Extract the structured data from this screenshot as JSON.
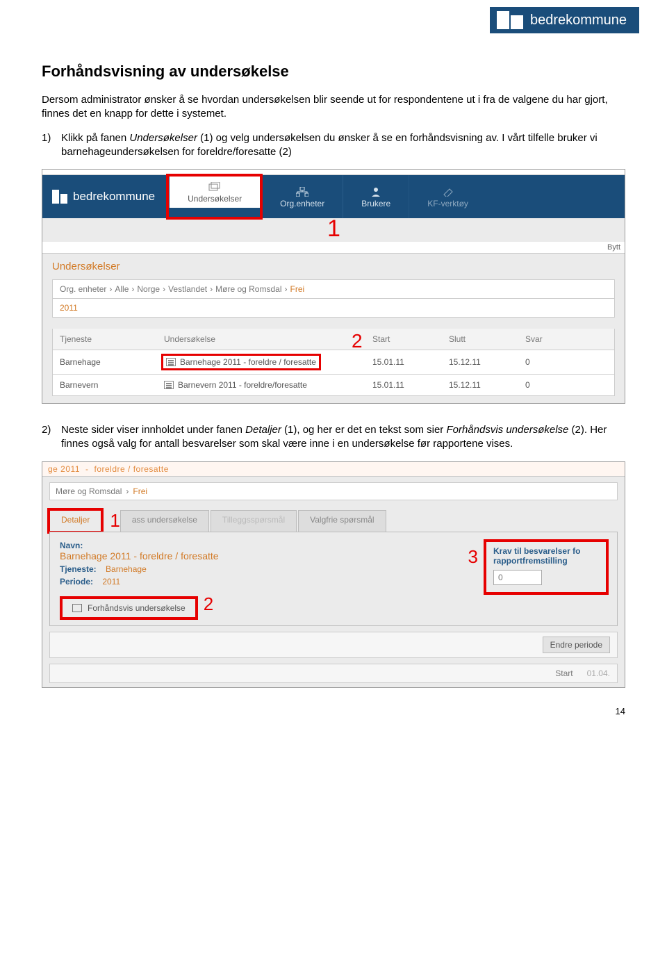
{
  "logo_text": "bedrekommune",
  "title": "Forhåndsvisning av undersøkelse",
  "intro": "Dersom administrator ønsker å se hvordan undersøkelsen blir seende ut for respondentene ut i fra de valgene du har gjort, finnes det en knapp for dette i systemet.",
  "step1_a": "Klikk på fanen ",
  "step1_i": "Undersøkelser",
  "step1_b": " (1) og velg undersøkelsen du ønsker å se en forhåndsvisning av. I vårt tilfelle bruker vi barnehageundersøkelsen for foreldre/foresatte (2)",
  "step1_num": "1)",
  "shot1": {
    "brand": "bedrekommune",
    "tabs": {
      "t1": "Undersøkelser",
      "t2": "Org.enheter",
      "t3": "Brukere",
      "t4": "KF-verktøy"
    },
    "marker1": "1",
    "bytt": "Bytt",
    "panel_title": "Undersøkelser",
    "crumbs": {
      "c0": "Org. enheter",
      "c1": "Alle",
      "c2": "Norge",
      "c3": "Vestlandet",
      "c4": "Møre og Romsdal",
      "c5": "Frei",
      "sep": "›"
    },
    "year": "2011",
    "cols": {
      "tjeneste": "Tjeneste",
      "under": "Undersøkelse",
      "start": "Start",
      "slutt": "Slutt",
      "svar": "Svar"
    },
    "marker2": "2",
    "rows": [
      {
        "tjeneste": "Barnehage",
        "under": "Barnehage 2011 - foreldre / foresatte",
        "start": "15.01.11",
        "slutt": "15.12.11",
        "svar": "0"
      },
      {
        "tjeneste": "Barnevern",
        "under": "Barnevern 2011 - foreldre/foresatte",
        "start": "15.01.11",
        "slutt": "15.12.11",
        "svar": "0"
      }
    ]
  },
  "step2_num": "2)",
  "step2_a": "Neste sider viser innholdet under fanen ",
  "step2_i1": "Detaljer",
  "step2_b": " (1), og her er det en tekst som sier ",
  "step2_i2": "Forhåndsvis undersøkelse",
  "step2_c": " (2). Her finnes også valg for antall besvarelser som skal være inne i en undersøkelse før rapportene vises.",
  "shot2": {
    "topstrip_a": "ge 2011",
    "topstrip_b": "foreldre / foresatte",
    "crumb_a": "Møre og Romsdal",
    "crumb_sep": "›",
    "crumb_b": "Frei",
    "tabs": {
      "t1": "Detaljer",
      "t2": "ass undersøkelse",
      "t3": "Tilleggsspørsmål",
      "t4": "Valgfrie spørsmål"
    },
    "marker1": "1",
    "navn_label": "Navn:",
    "navn_value": "Barnehage 2011 - foreldre / foresatte",
    "tjeneste_label": "Tjeneste:",
    "tjeneste_value": "Barnehage",
    "periode_label": "Periode:",
    "periode_value": "2011",
    "preview": "Forhåndsvis undersøkelse",
    "marker2": "2",
    "marker3": "3",
    "right_label_a": "Krav til besvarelser fo",
    "right_label_b": "rapportfremstilling",
    "right_value": "0",
    "endre": "Endre periode",
    "start_label": "Start",
    "start_value": "01.04."
  },
  "pagenum": "14"
}
